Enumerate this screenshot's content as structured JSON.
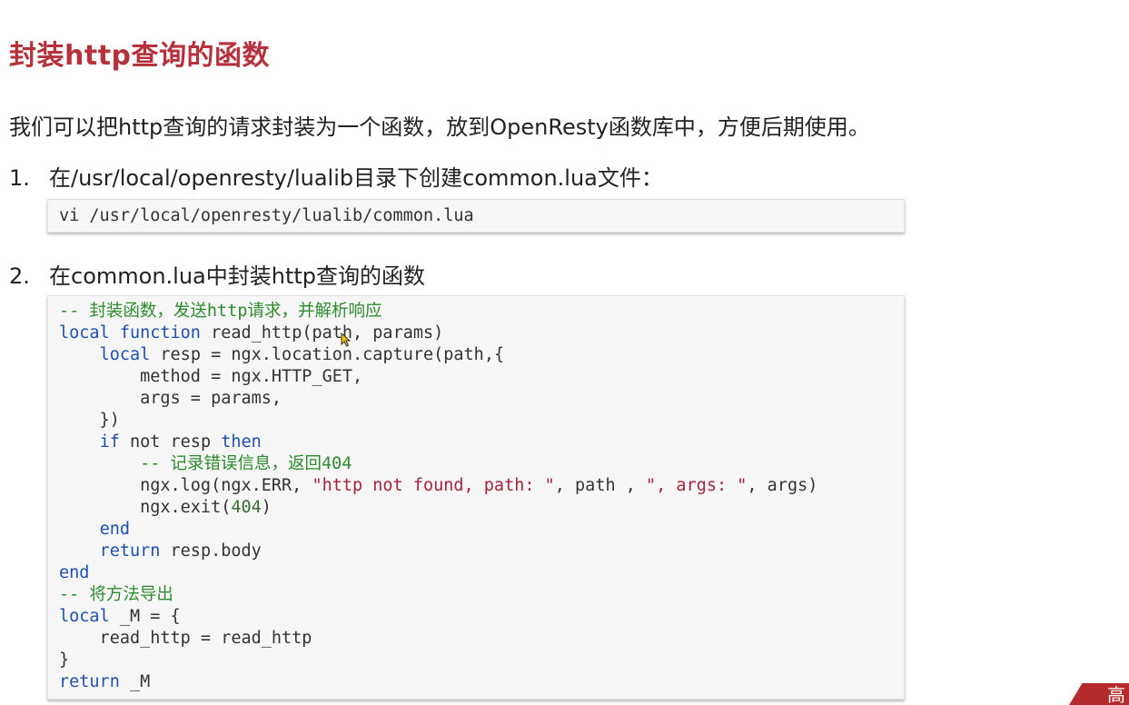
{
  "title": "封装http查询的函数",
  "intro": "我们可以把http查询的请求封装为一个函数，放到OpenResty函数库中，方便后期使用。",
  "steps": [
    {
      "number": "1.",
      "text": "在/usr/local/openresty/lualib目录下创建common.lua文件："
    },
    {
      "number": "2.",
      "text": "在common.lua中封装http查询的函数"
    }
  ],
  "command": "vi /usr/local/openresty/lualib/common.lua",
  "code": {
    "c_comment1": "-- 封装函数，发送http请求，并解析响应",
    "l1_local": "local",
    "l1_function": "function",
    "l1_rest": " read_http(path, params)",
    "l2_indent": "    ",
    "l2_local": "local",
    "l2_rest": " resp = ngx.location.capture(path,{",
    "l3": "        method = ngx.HTTP_GET,",
    "l4": "        args = params,",
    "l5": "    })",
    "l6_indent": "    ",
    "l6_if": "if",
    "l6_mid": " not resp ",
    "l6_then": "then",
    "c_comment2": "        -- 记录错误信息，返回404",
    "l8_a": "        ngx.log(ngx.ERR, ",
    "l8_s1": "\"http not found, path: \"",
    "l8_b": ", path , ",
    "l8_s2": "\", args: \"",
    "l8_c": ", args)",
    "l9_a": "        ngx.exit(",
    "l9_num": "404",
    "l9_b": ")",
    "l10_indent": "    ",
    "l10_end": "end",
    "l11_indent": "    ",
    "l11_return": "return",
    "l11_rest": " resp.body",
    "l12_end": "end",
    "c_comment3": "-- 将方法导出",
    "l14_local": "local",
    "l14_rest": " _M = {",
    "l15": "    read_http = read_http",
    "l16": "}",
    "l17_return": "return",
    "l17_rest": " _M"
  },
  "corner_badge": "高",
  "colors": {
    "title": "#b5313c",
    "keyword": "#1f4fb0",
    "comment": "#2e8a2e",
    "string": "#a3243b",
    "badge": "#b52a2a"
  },
  "icons": {
    "cursor": "mouse-pointer-icon"
  }
}
